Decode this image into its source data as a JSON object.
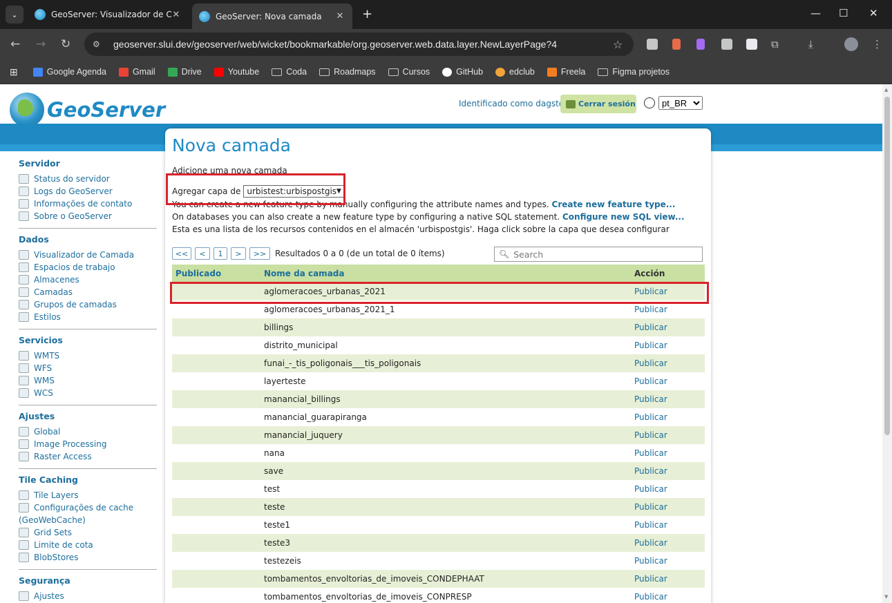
{
  "browser": {
    "tabs": [
      {
        "title": "GeoServer: Visualizador de Cam",
        "active": false
      },
      {
        "title": "GeoServer: Nova camada",
        "active": true
      }
    ],
    "url": "geoserver.slui.dev/geoserver/web/wicket/bookmarkable/org.geoserver.web.data.layer.NewLayerPage?4",
    "bookmarks": [
      {
        "label": "Google Agenda",
        "icon": "calendar-icon",
        "color": "#4285f4"
      },
      {
        "label": "Gmail",
        "icon": "gmail-icon",
        "color": "#ea4335"
      },
      {
        "label": "Drive",
        "icon": "drive-icon",
        "color": "#34a853"
      },
      {
        "label": "Youtube",
        "icon": "youtube-icon",
        "color": "#ff0000"
      },
      {
        "label": "Coda",
        "icon": "folder-icon",
        "color": ""
      },
      {
        "label": "Roadmaps",
        "icon": "folder-icon",
        "color": ""
      },
      {
        "label": "Cursos",
        "icon": "folder-icon",
        "color": ""
      },
      {
        "label": "GitHub",
        "icon": "github-icon",
        "color": "#ffffff"
      },
      {
        "label": "edclub",
        "icon": "edclub-icon",
        "color": "#f2a33a"
      },
      {
        "label": "Freela",
        "icon": "freela-icon",
        "color": "#f57c1f"
      },
      {
        "label": "Figma projetos",
        "icon": "folder-icon",
        "color": ""
      }
    ]
  },
  "header": {
    "logo_text": "GeoServer",
    "user_text": "Identificado como dagster.",
    "logout_label": "Cerrar sesión",
    "lang_value": "pt_BR"
  },
  "sidebar": [
    {
      "title": "Servidor",
      "items": [
        "Status do servidor",
        "Logs do GeoServer",
        "Informações de contato",
        "Sobre o GeoServer"
      ]
    },
    {
      "title": "Dados",
      "items": [
        "Visualizador de Camada",
        "Espacios de trabajo",
        "Almacenes",
        "Camadas",
        "Grupos de camadas",
        "Estilos"
      ]
    },
    {
      "title": "Servicios",
      "items": [
        "WMTS",
        "WFS",
        "WMS",
        "WCS"
      ]
    },
    {
      "title": "Ajustes",
      "items": [
        "Global",
        "Image Processing",
        "Raster Access"
      ]
    },
    {
      "title": "Tile Caching",
      "items": [
        "Tile Layers",
        "Configurações de cache",
        "(GeoWebCache)",
        "Grid Sets",
        "Limite de cota",
        "BlobStores"
      ]
    },
    {
      "title": "Segurança",
      "items": [
        "Ajustes"
      ]
    }
  ],
  "main": {
    "title": "Nova camada",
    "subtitle": "Adicione uma nova camada",
    "add_from_label": "Agregar capa de",
    "store_value": "urbistest:urbispostgis",
    "line1_text": "You can create a new feature type by manually configuring the attribute names and types.",
    "line1_link": "Create new feature type...",
    "line2_text": "On databases you can also create a new feature type by configuring a native SQL statement.",
    "line2_link": "Configure new SQL view...",
    "line3_text": "Esta es una lista de los recursos contenidos en el almacén 'urbispostgis'. Haga click sobre la capa que desea configurar",
    "pager": {
      "first": "<<",
      "prev": "<",
      "page": "1",
      "next": ">",
      "last": ">>",
      "results": "Resultados 0 a 0 (de un total de 0 ítems)"
    },
    "search_placeholder": "Search",
    "columns": [
      "Publicado",
      "Nome da camada",
      "Acción"
    ],
    "rows": [
      {
        "published": "",
        "name": "aglomeracoes_urbanas_2021",
        "action": "Publicar"
      },
      {
        "published": "",
        "name": "aglomeracoes_urbanas_2021_1",
        "action": "Publicar"
      },
      {
        "published": "",
        "name": "billings",
        "action": "Publicar"
      },
      {
        "published": "",
        "name": "distrito_municipal",
        "action": "Publicar"
      },
      {
        "published": "",
        "name": "funai_-_tis_poligonais___tis_poligonais",
        "action": "Publicar"
      },
      {
        "published": "",
        "name": "layerteste",
        "action": "Publicar"
      },
      {
        "published": "",
        "name": "manancial_billings",
        "action": "Publicar"
      },
      {
        "published": "",
        "name": "manancial_guarapiranga",
        "action": "Publicar"
      },
      {
        "published": "",
        "name": "manancial_juquery",
        "action": "Publicar"
      },
      {
        "published": "",
        "name": "nana",
        "action": "Publicar"
      },
      {
        "published": "",
        "name": "save",
        "action": "Publicar"
      },
      {
        "published": "",
        "name": "test",
        "action": "Publicar"
      },
      {
        "published": "",
        "name": "teste",
        "action": "Publicar"
      },
      {
        "published": "",
        "name": "teste1",
        "action": "Publicar"
      },
      {
        "published": "",
        "name": "teste3",
        "action": "Publicar"
      },
      {
        "published": "",
        "name": "testezeis",
        "action": "Publicar"
      },
      {
        "published": "",
        "name": "tombamentos_envoltorias_de_imoveis_CONDEPHAAT",
        "action": "Publicar"
      },
      {
        "published": "",
        "name": "tombamentos_envoltorias_de_imoveis_CONPRESP",
        "action": "Publicar"
      }
    ]
  },
  "colors": {
    "accent": "#1e8ac4",
    "header_row": "#c9e0a2",
    "stripe": "#e7f0d6",
    "highlight": "#d9232a"
  }
}
